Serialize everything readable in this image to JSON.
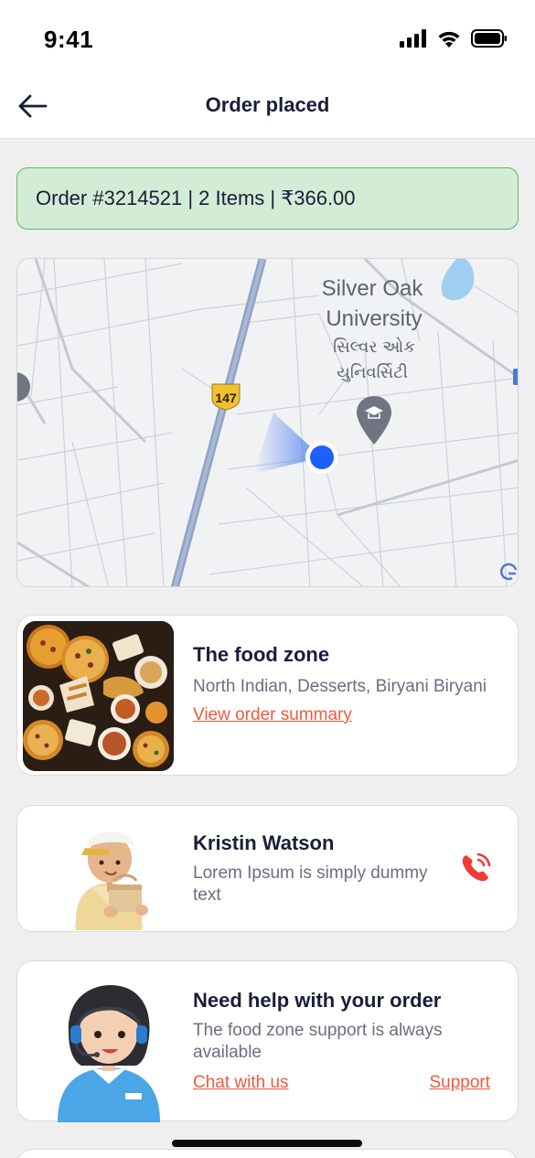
{
  "status_bar": {
    "time": "9:41",
    "icons": [
      "cellular-signal-icon",
      "wifi-icon",
      "battery-icon"
    ]
  },
  "header": {
    "title": "Order placed",
    "back_icon": "arrow-left-icon"
  },
  "order_banner": {
    "text": "Order #3214521 | 2 Items | ₹366.00"
  },
  "map": {
    "labels": {
      "place_name_line1": "Silver Oak",
      "place_name_line2": "University",
      "place_name_gujarati_line1": "સિલ્વર ઓક",
      "place_name_gujarati_line2": "યુનિવર્સિટી",
      "road_shield": "147"
    }
  },
  "restaurant": {
    "name": "The food zone",
    "cuisines": "North Indian, Desserts, Biryani Biryani",
    "summary_link": "View order summary"
  },
  "rider": {
    "name": "Kristin Watson",
    "description": "Lorem Ipsum is simply dummy text",
    "call_icon": "phone-icon"
  },
  "help": {
    "title": "Need help with your order",
    "description": "The food zone support is always available",
    "chat_link": "Chat with us",
    "support_link": "Support"
  },
  "colors": {
    "accent": "#ee5a3c",
    "banner_bg": "#d3ecd5",
    "banner_border": "#5cb85c",
    "title_text": "#1a1d3a",
    "location_dot": "#1f5eff"
  }
}
